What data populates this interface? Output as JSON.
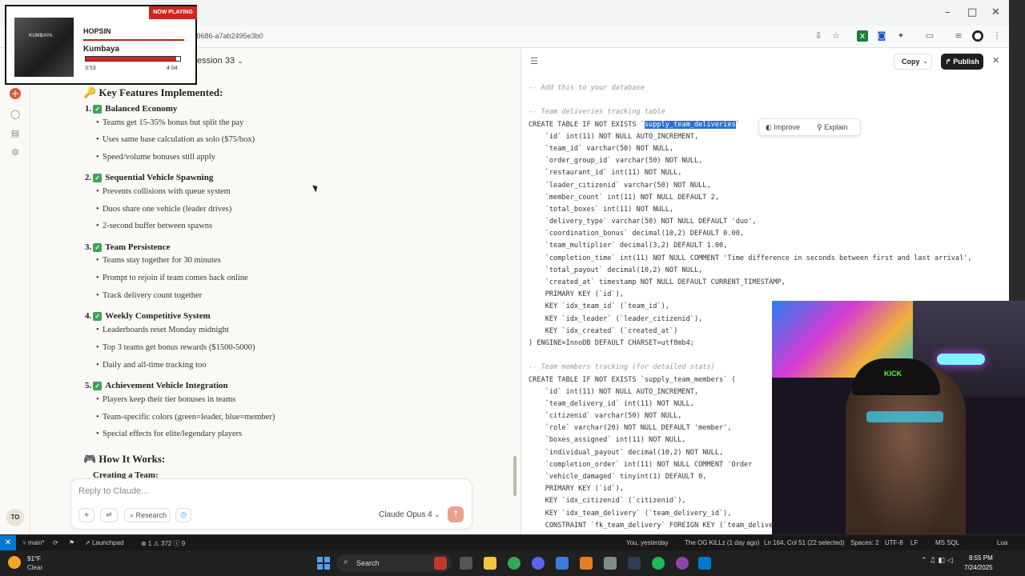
{
  "browser": {
    "url_fragment": "f-9686-a7ab2495e3b0"
  },
  "chat": {
    "title": "ession 33",
    "features_heading": "🔑 Key Features Implemented:",
    "sections": [
      {
        "number": "1.",
        "title": "Balanced Economy",
        "bullets": [
          "Teams get 15-35% bonus but split the pay",
          "Uses same base calculation as solo ($75/box)",
          "Speed/volume bonuses still apply"
        ]
      },
      {
        "number": "2.",
        "title": "Sequential Vehicle Spawning",
        "bullets": [
          "Prevents collisions with queue system",
          "Duos share one vehicle (leader drives)",
          "2-second buffer between spawns"
        ]
      },
      {
        "number": "3.",
        "title": "Team Persistence",
        "bullets": [
          "Teams stay together for 30 minutes",
          "Prompt to rejoin if team comes back online",
          "Track delivery count together"
        ]
      },
      {
        "number": "4.",
        "title": "Weekly Competitive System",
        "bullets": [
          "Leaderboards reset Monday midnight",
          "Top 3 teams get bonus rewards ($1500-5000)",
          "Daily and all-time tracking too"
        ]
      },
      {
        "number": "5.",
        "title": "Achievement Vehicle Integration",
        "bullets": [
          "Players keep their tier bonuses in teams",
          "Team-specific colors (green=leader, blue=member)",
          "Special effects for elite/legendary players"
        ]
      }
    ],
    "how_heading": "🎮 How It Works:",
    "creating_heading": "Creating a Team:",
    "composer": {
      "placeholder": "Reply to Claude...",
      "research_label": "Research",
      "model_label": "Claude Opus 4"
    },
    "avatar_initials": "TO"
  },
  "artifact": {
    "copy_label": "Copy",
    "publish_label": "Publish",
    "popover": {
      "improve_label": "Improve",
      "explain_label": "Explain"
    },
    "code_lines": [
      {
        "t": "-- Add this to your database",
        "c": "cm"
      },
      {
        "t": "",
        "c": ""
      },
      {
        "t": "-- Team deliveries tracking table",
        "c": "cm"
      },
      {
        "t": "CREATE TABLE IF NOT EXISTS `",
        "c": "",
        "hl": "supply_team_deliveries",
        "after": "`"
      },
      {
        "t": "    `id` int(11) NOT NULL AUTO_INCREMENT,",
        "c": ""
      },
      {
        "t": "    `team_id` varchar(50) NOT NULL,",
        "c": ""
      },
      {
        "t": "    `order_group_id` varchar(50) NOT NULL,",
        "c": ""
      },
      {
        "t": "    `restaurant_id` int(11) NOT NULL,",
        "c": ""
      },
      {
        "t": "    `leader_citizenid` varchar(50) NOT NULL,",
        "c": ""
      },
      {
        "t": "    `member_count` int(11) NOT NULL DEFAULT 2,",
        "c": ""
      },
      {
        "t": "    `total_boxes` int(11) NOT NULL,",
        "c": ""
      },
      {
        "t": "    `delivery_type` varchar(50) NOT NULL DEFAULT 'duo',",
        "c": ""
      },
      {
        "t": "    `coordination_bonus` decimal(10,2) DEFAULT 0.00,",
        "c": ""
      },
      {
        "t": "    `team_multiplier` decimal(3,2) DEFAULT 1.00,",
        "c": ""
      },
      {
        "t": "    `completion_time` int(11) NOT NULL COMMENT 'Time difference in seconds between first and last arrival',",
        "c": ""
      },
      {
        "t": "    `total_payout` decimal(10,2) NOT NULL,",
        "c": ""
      },
      {
        "t": "    `created_at` timestamp NOT NULL DEFAULT CURRENT_TIMESTAMP,",
        "c": ""
      },
      {
        "t": "    PRIMARY KEY (`id`),",
        "c": ""
      },
      {
        "t": "    KEY `idx_team_id` (`team_id`),",
        "c": ""
      },
      {
        "t": "    KEY `idx_leader` (`leader_citizenid`),",
        "c": ""
      },
      {
        "t": "    KEY `idx_created` (`created_at`)",
        "c": ""
      },
      {
        "t": ") ENGINE=InnoDB DEFAULT CHARSET=utf8mb4;",
        "c": ""
      },
      {
        "t": "",
        "c": ""
      },
      {
        "t": "-- Team members tracking (for detailed stats)",
        "c": "cm"
      },
      {
        "t": "CREATE TABLE IF NOT EXISTS `supply_team_members` (",
        "c": ""
      },
      {
        "t": "    `id` int(11) NOT NULL AUTO_INCREMENT,",
        "c": ""
      },
      {
        "t": "    `team_delivery_id` int(11) NOT NULL,",
        "c": ""
      },
      {
        "t": "    `citizenid` varchar(50) NOT NULL,",
        "c": ""
      },
      {
        "t": "    `role` varchar(20) NOT NULL DEFAULT 'member',",
        "c": ""
      },
      {
        "t": "    `boxes_assigned` int(11) NOT NULL,",
        "c": ""
      },
      {
        "t": "    `individual_payout` decimal(10,2) NOT NULL,",
        "c": ""
      },
      {
        "t": "    `completion_order` int(11) NOT NULL COMMENT 'Order",
        "c": ""
      },
      {
        "t": "    `vehicle_damaged` tinyint(1) DEFAULT 0,",
        "c": ""
      },
      {
        "t": "    PRIMARY KEY (`id`),",
        "c": ""
      },
      {
        "t": "    KEY `idx_citizenid` (`citizenid`),",
        "c": ""
      },
      {
        "t": "    KEY `idx_team_delivery` (`team_delivery_id`),",
        "c": ""
      },
      {
        "t": "    CONSTRAINT `fk_team_delivery` FOREIGN KEY (`team_deliver",
        "c": ""
      }
    ]
  },
  "now_playing": {
    "tag": "NOW PLAYING",
    "artist": "HOPSIN",
    "song": "Kumbaya",
    "elapsed": "3:53",
    "total": "4:04",
    "progress": 0.955,
    "art_text": "KUMBAYA"
  },
  "webcam": {
    "hat_text": "KICK"
  },
  "statusbar": {
    "branch": "main*",
    "launchpad": "Launchpad",
    "problems": "⊗ 1 ⚠ 372 ⓘ 9",
    "blame": "You, yesterday",
    "track": "The OG KiLLz (1 day ago)",
    "position": "Ln 164, Col 51 (22 selected)",
    "spaces": "Spaces: 2",
    "encoding": "UTF-8",
    "eol": "LF",
    "language": "MS SQL",
    "lua": "Lua"
  },
  "taskbar": {
    "temperature": "91°F",
    "weather": "Clear",
    "search_label": "Search",
    "time": "8:55 PM",
    "date": "7/24/2025"
  },
  "colors": {
    "accent": "#d9573b",
    "publish": "#1e1e1e",
    "highlight": "#2f6fd6",
    "now_playing_red": "#d0261c"
  }
}
